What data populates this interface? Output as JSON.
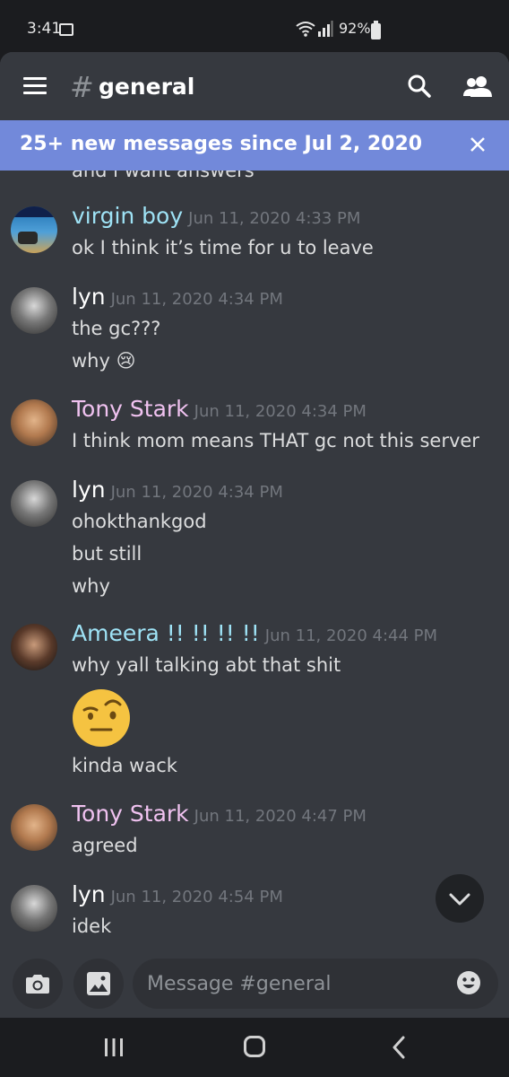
{
  "status_bar": {
    "time": "3:41",
    "battery": "92%",
    "icons": [
      "gallery-icon",
      "wifi-icon",
      "signal-icon",
      "battery-icon"
    ]
  },
  "header": {
    "hash": "#",
    "channel": "general",
    "icons": [
      "menu-icon",
      "search-icon",
      "members-icon"
    ]
  },
  "banner": {
    "text": "25+ new messages since Jul 2, 2020",
    "bg": "#7289da",
    "close_icon": "close-icon"
  },
  "partial_message": "and i want answers",
  "messages": [
    {
      "author": "virgin boy",
      "color": "#9ee2f5",
      "timestamp": "Jun 11, 2020 4:33 PM",
      "lines": [
        "ok I think it’s time for u to leave"
      ]
    },
    {
      "author": "lyn",
      "color": "#ffffff",
      "timestamp": "Jun 11, 2020 4:34 PM",
      "lines": [
        "the gc???",
        "why 😢"
      ]
    },
    {
      "author": "Tony Stark",
      "color": "#f0c2f0",
      "timestamp": "Jun 11, 2020 4:34 PM",
      "lines": [
        "I think mom means THAT gc not this server"
      ]
    },
    {
      "author": "lyn",
      "color": "#ffffff",
      "timestamp": "Jun 11, 2020 4:34 PM",
      "lines": [
        "ohokthankgod",
        "but still",
        "why"
      ]
    },
    {
      "author": "Ameera !! !! !! !!",
      "color": "#9ee2f5",
      "timestamp": "Jun 11, 2020 4:44 PM",
      "lines": [
        "why yall talking abt that shit",
        "kinda wack"
      ],
      "emoji": "raised-eyebrow-emoji"
    },
    {
      "author": "Tony Stark",
      "color": "#f0c2f0",
      "timestamp": "Jun 11, 2020 4:47 PM",
      "lines": [
        "agreed"
      ]
    },
    {
      "author": "lyn",
      "color": "#ffffff",
      "timestamp": "Jun 11, 2020 4:54 PM",
      "lines": [
        "idek"
      ]
    }
  ],
  "composer": {
    "placeholder": "Message #general",
    "icons": [
      "camera-icon",
      "image-icon",
      "emoji-icon"
    ]
  },
  "scroll_button": "chevron-down-icon",
  "nav": {
    "icons": [
      "recents-icon",
      "home-icon",
      "back-icon"
    ]
  }
}
